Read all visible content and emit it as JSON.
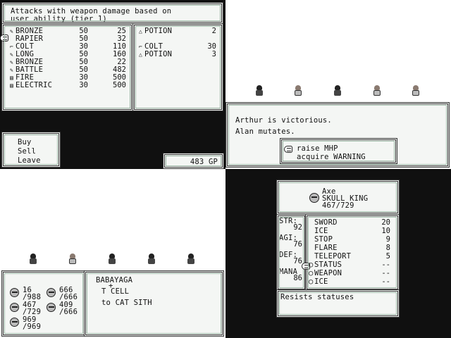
{
  "shop": {
    "description_line1": "Attacks with weapon damage based on",
    "description_line2": "user ability (tier 1)",
    "items": [
      {
        "icon": "sword-icon",
        "glyph": "✎",
        "name": "BRONZE",
        "col1": "50",
        "col2": "25"
      },
      {
        "icon": "sword-icon",
        "glyph": "",
        "name": "RAPIER",
        "col1": "50",
        "col2": "32"
      },
      {
        "icon": "gun-icon",
        "glyph": "⌐",
        "name": "COLT",
        "col1": "30",
        "col2": "110"
      },
      {
        "icon": "sword-icon",
        "glyph": "✎",
        "name": "LONG",
        "col1": "50",
        "col2": "160"
      },
      {
        "icon": "sword-icon",
        "glyph": "✎",
        "name": "BRONZE",
        "col1": "50",
        "col2": "22"
      },
      {
        "icon": "axe-icon",
        "glyph": "✎",
        "name": "BATTLE",
        "col1": "50",
        "col2": "482"
      },
      {
        "icon": "book-icon",
        "glyph": "▤",
        "name": "FIRE",
        "col1": "30",
        "col2": "500"
      },
      {
        "icon": "book-icon",
        "glyph": "▤",
        "name": "ELECTRIC",
        "col1": "30",
        "col2": "500"
      }
    ],
    "inventory": [
      {
        "icon": "potion-icon",
        "glyph": "△",
        "name": "POTION",
        "qty": "2"
      },
      {
        "icon": "gun-icon",
        "glyph": "⌐",
        "name": "COLT",
        "qty": "30"
      },
      {
        "icon": "potion-icon",
        "glyph": "△",
        "name": "POTION",
        "qty": "3"
      }
    ],
    "menu": [
      "Buy",
      "Sell",
      "Leave"
    ],
    "gold": "483 GP"
  },
  "battle_result": {
    "line1": "Arthur is victorious.",
    "line2": "Alan mutates.",
    "choices": [
      "raise MHP",
      "acquire WARNING"
    ]
  },
  "combine": {
    "party_hp": [
      {
        "hp": "16",
        "max": "/988"
      },
      {
        "hp": "666",
        "max": "/666"
      },
      {
        "hp": "467",
        "max": "/729"
      },
      {
        "hp": "409",
        "max": "/666"
      },
      {
        "hp": "969",
        "max": "/969"
      }
    ],
    "line1": "BABAYAGA",
    "plus": "+",
    "line2": "T CELL",
    "line3": "to CAT SITH"
  },
  "status": {
    "weapon": "Axe",
    "name": "SKULL KING",
    "hp": "467/729",
    "stats": [
      {
        "label": "STR:",
        "value": "92"
      },
      {
        "label": "AGI:",
        "value": "76"
      },
      {
        "label": "DEF:",
        "value": "76"
      },
      {
        "label": "MANA",
        "value": "86"
      }
    ],
    "abilities": [
      {
        "bullet": "",
        "name": "SWORD",
        "uses": "20"
      },
      {
        "bullet": "",
        "name": "ICE",
        "uses": "10"
      },
      {
        "bullet": "",
        "name": "STOP",
        "uses": "9"
      },
      {
        "bullet": "",
        "name": "FLARE",
        "uses": "8"
      },
      {
        "bullet": "",
        "name": "TELEPORT",
        "uses": "5"
      },
      {
        "bullet": "○",
        "name": "STATUS",
        "uses": "--"
      },
      {
        "bullet": "○",
        "name": "WEAPON",
        "uses": "--"
      },
      {
        "bullet": "○",
        "name": "ICE",
        "uses": "--"
      }
    ],
    "description": "Resists statuses"
  }
}
